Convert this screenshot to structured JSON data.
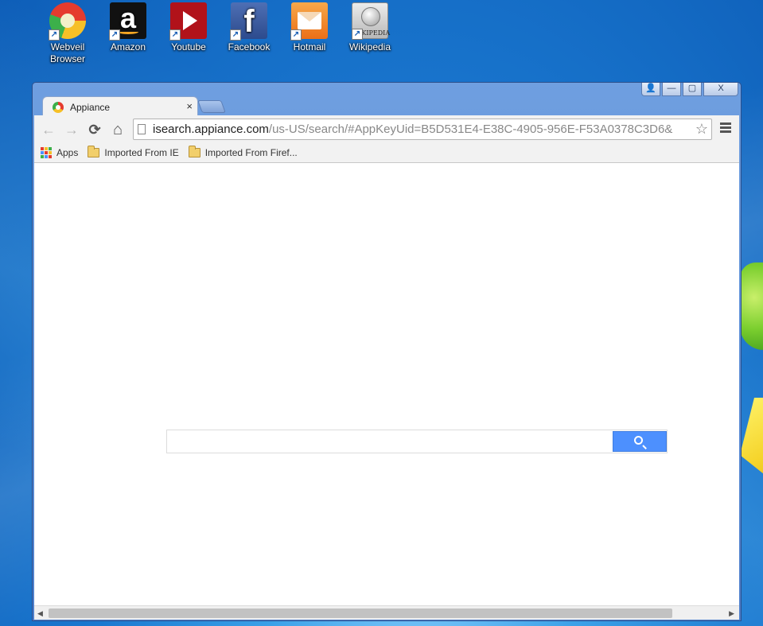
{
  "desktop": {
    "icons": [
      {
        "label": "Webveil\nBrowser",
        "line1": "Webveil",
        "line2": "Browser",
        "icon": "webveil-icon"
      },
      {
        "label": "Amazon",
        "icon": "amazon-icon"
      },
      {
        "label": "Youtube",
        "icon": "youtube-icon"
      },
      {
        "label": "Facebook",
        "icon": "facebook-icon"
      },
      {
        "label": "Hotmail",
        "icon": "hotmail-icon"
      },
      {
        "label": "Wikipedia",
        "icon": "wikipedia-icon"
      }
    ],
    "amazon_glyph": "a",
    "facebook_glyph": "f",
    "wikipedia_glyph": "WIKIPEDIA"
  },
  "browser": {
    "window_controls": {
      "user": "👤",
      "minimize": "—",
      "maximize": "▢",
      "close": "X"
    },
    "tab": {
      "title": "Appiance",
      "close": "×"
    },
    "nav": {
      "back": "←",
      "forward": "→",
      "reload": "⟳",
      "home": "⌂"
    },
    "omnibox": {
      "host": "isearch.appiance.com",
      "path": "/us-US/search/#AppKeyUid=B5D531E4-E38C-4905-956E-F53A0378C3D6&",
      "star": "☆"
    },
    "bookmarks": [
      {
        "label": "Apps"
      },
      {
        "label": "Imported From IE"
      },
      {
        "label": "Imported From Firef..."
      }
    ],
    "search": {
      "placeholder": "",
      "value": ""
    }
  },
  "colors": {
    "accent": "#4d90fe",
    "window_frame": "#6f9fe0"
  }
}
